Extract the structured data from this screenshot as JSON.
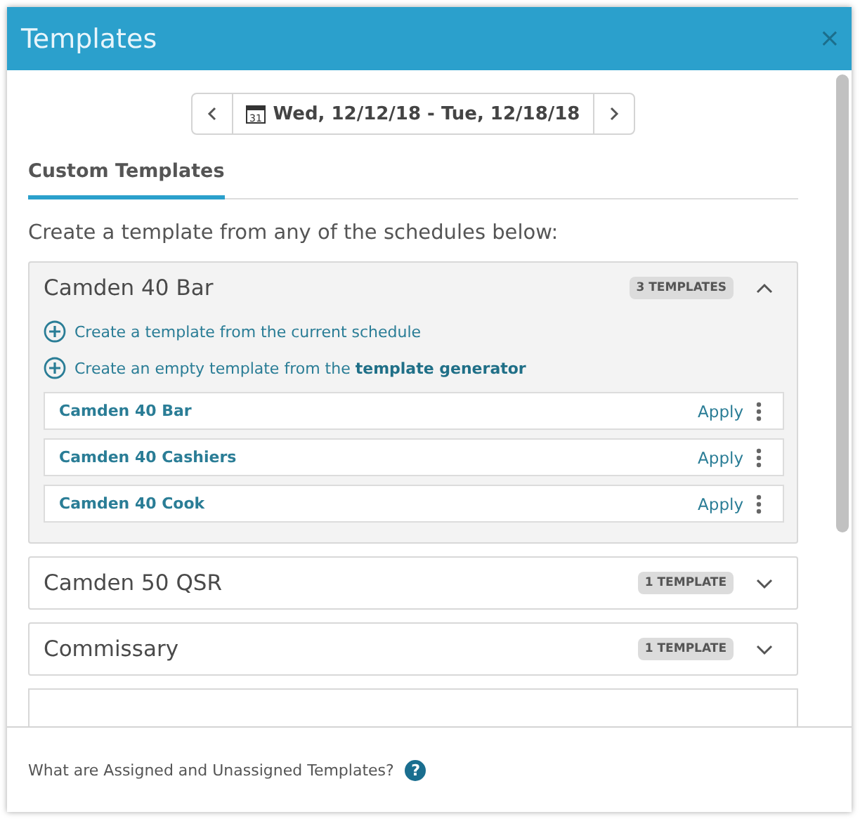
{
  "window": {
    "title": "Templates",
    "close": "×"
  },
  "date_range": {
    "calendar_day": "31",
    "label": "Wed, 12/12/18 - Tue, 12/18/18"
  },
  "tabs": [
    {
      "label": "Custom Templates",
      "selected": true
    }
  ],
  "intro": "Create a template from any of the schedules below:",
  "groups": [
    {
      "name": "Camden 40 Bar",
      "badge": "3 TEMPLATES",
      "expanded": true,
      "actions": [
        "Create a template from the current schedule",
        "Create an empty template from the **template generator**"
      ],
      "templates": [
        {
          "name": "Camden 40 Bar",
          "apply": "Apply"
        },
        {
          "name": "Camden 40 Cashiers",
          "apply": "Apply"
        },
        {
          "name": "Camden 40 Cook",
          "apply": "Apply"
        }
      ]
    },
    {
      "name": "Camden 50 QSR",
      "badge": "1 TEMPLATE",
      "expanded": false
    },
    {
      "name": "Commissary",
      "badge": "1 TEMPLATE",
      "expanded": false
    }
  ],
  "footer": {
    "help_text": "What are Assigned and Unassigned Templates?",
    "help_icon": "?"
  }
}
